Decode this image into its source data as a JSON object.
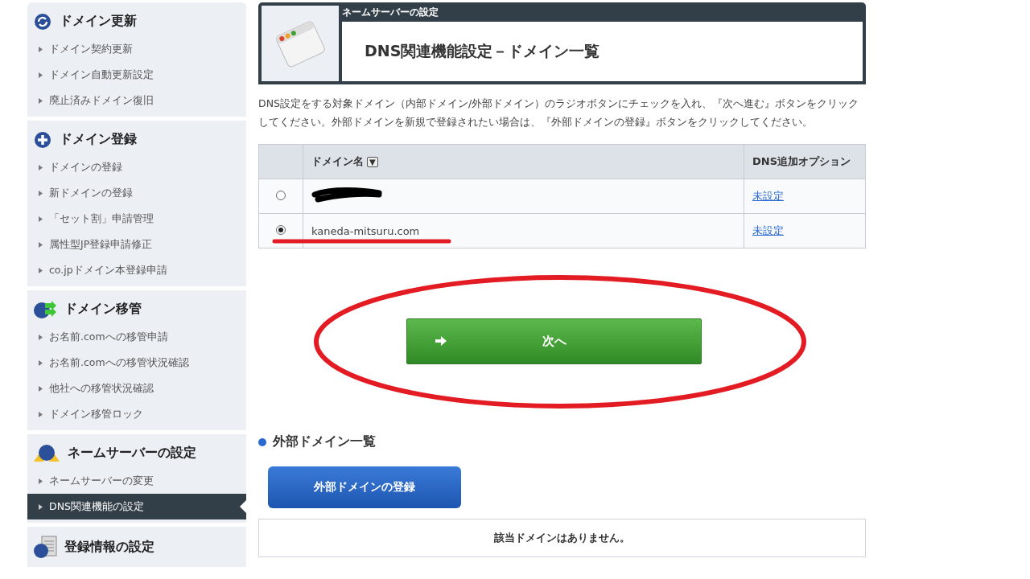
{
  "sidebar": [
    {
      "heading": "ドメイン更新",
      "kind": "refresh",
      "items": [
        {
          "label": "ドメイン契約更新",
          "selected": false
        },
        {
          "label": "ドメイン自動更新設定",
          "selected": false
        },
        {
          "label": "廃止済みドメイン復旧",
          "selected": false
        }
      ]
    },
    {
      "heading": "ドメイン登録",
      "kind": "plus",
      "items": [
        {
          "label": "ドメインの登録",
          "selected": false
        },
        {
          "label": "新ドメインの登録",
          "selected": false
        },
        {
          "label": "「セット割」申請管理",
          "selected": false
        },
        {
          "label": "属性型JP登録申請修正",
          "selected": false
        },
        {
          "label": "co.jpドメイン本登録申請",
          "selected": false
        }
      ]
    },
    {
      "heading": "ドメイン移管",
      "kind": "transfer",
      "items": [
        {
          "label": "お名前.comへの移管申請",
          "selected": false
        },
        {
          "label": "お名前.comへの移管状況確認",
          "selected": false
        },
        {
          "label": "他社への移管状況確認",
          "selected": false
        },
        {
          "label": "ドメイン移管ロック",
          "selected": false
        }
      ]
    },
    {
      "heading": "ネームサーバーの設定",
      "kind": "server",
      "items": [
        {
          "label": "ネームサーバーの変更",
          "selected": false
        },
        {
          "label": "DNS関連機能の設定",
          "selected": true
        }
      ]
    },
    {
      "heading": "登録情報の設定",
      "kind": "document"
    }
  ],
  "header": {
    "category": "ネームサーバーの設定",
    "title": "DNS関連機能設定－ドメイン一覧"
  },
  "intro": "DNS設定をする対象ドメイン（内部ドメイン/外部ドメイン）のラジオボタンにチェックを入れ、『次へ進む』ボタンをクリックしてください。外部ドメインを新規で登録されたい場合は、『外部ドメインの登録』ボタンをクリックしてください。",
  "table": {
    "columns": [
      "ドメイン名",
      "DNS追加オプション"
    ],
    "sort_icon": "▼",
    "rows": [
      {
        "selected": false,
        "redacted": true,
        "underlined": false,
        "option": "未設定"
      },
      {
        "selected": true,
        "redacted": false,
        "domain": "kaneda-mitsuru.com",
        "underlined": true,
        "option": "未設定"
      }
    ]
  },
  "next_button": {
    "label": "次へ",
    "circled": true
  },
  "external": {
    "heading": "外部ドメイン一覧",
    "button": "外部ドメインの登録",
    "empty": "該当ドメインはありません。"
  }
}
